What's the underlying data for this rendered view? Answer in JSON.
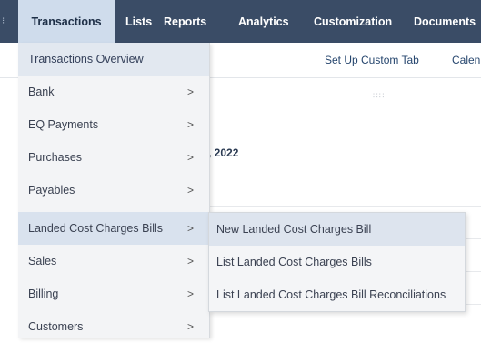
{
  "topnav": {
    "tabs": [
      {
        "label": "Transactions",
        "active": true
      },
      {
        "label": "Lists"
      },
      {
        "label": "Reports"
      },
      {
        "label": "Analytics"
      },
      {
        "label": "Customization"
      },
      {
        "label": "Documents"
      }
    ]
  },
  "subbar": {
    "links": [
      "Set Up Custom Tab",
      "Calen"
    ]
  },
  "page": {
    "date_fragment": ", 2022"
  },
  "menu": {
    "overview": "Transactions Overview",
    "items": [
      {
        "label": "Bank",
        "icon": "chevron-right-icon"
      },
      {
        "label": "EQ Payments",
        "icon": "chevron-right-icon"
      },
      {
        "label": "Purchases",
        "icon": "chevron-right-icon"
      },
      {
        "label": "Payables",
        "icon": "chevron-right-icon"
      },
      {
        "label": "Landed Cost Charges Bills",
        "icon": "chevron-right-icon",
        "selected": true
      },
      {
        "label": "Sales",
        "icon": "chevron-right-icon"
      },
      {
        "label": "Billing",
        "icon": "chevron-right-icon"
      },
      {
        "label": "Customers",
        "icon": "chevron-right-icon"
      }
    ],
    "chevron": ">"
  },
  "submenu": {
    "items": [
      "New Landed Cost Charges Bill",
      "List Landed Cost Charges Bills",
      "List Landed Cost Charges Bill Reconciliations"
    ]
  },
  "colors": {
    "nav_bg": "#3a4c66",
    "active_tab_bg": "#cfdcec",
    "menu_bg": "#f3f4f6",
    "selected_bg": "#d9e2ee",
    "link": "#26466e"
  }
}
